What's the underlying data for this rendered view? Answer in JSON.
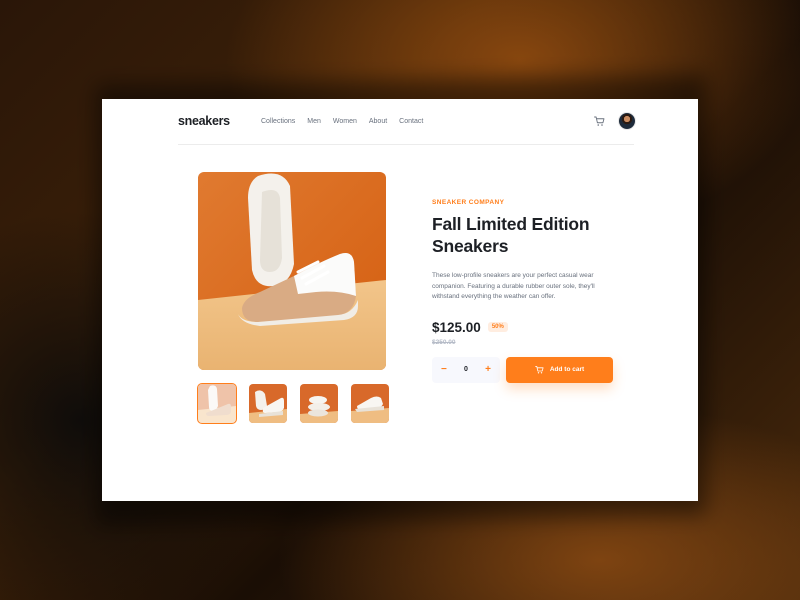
{
  "header": {
    "logo": "sneakers",
    "nav": [
      "Collections",
      "Men",
      "Women",
      "About",
      "Contact"
    ],
    "cart_icon": "cart-icon",
    "avatar_icon": "avatar"
  },
  "product": {
    "company": "SNEAKER COMPANY",
    "title_line1": "Fall Limited Edition",
    "title_line2": "Sneakers",
    "description": "These low-profile sneakers are your perfect casual wear companion. Featuring a durable rubber outer sole, they'll withstand everything the weather can offer.",
    "price": "$125.00",
    "discount": "50%",
    "old_price": "$250.00"
  },
  "cart": {
    "quantity": "0",
    "minus": "−",
    "plus": "+",
    "add_label": "Add to cart"
  },
  "gallery": {
    "thumbnail_count": 4,
    "active_index": 0
  },
  "colors": {
    "accent": "#ff7e1b",
    "accent_pale": "#ffede0",
    "text_dark": "#1d2025",
    "text_muted": "#68707d",
    "text_light": "#b6bcc8"
  }
}
